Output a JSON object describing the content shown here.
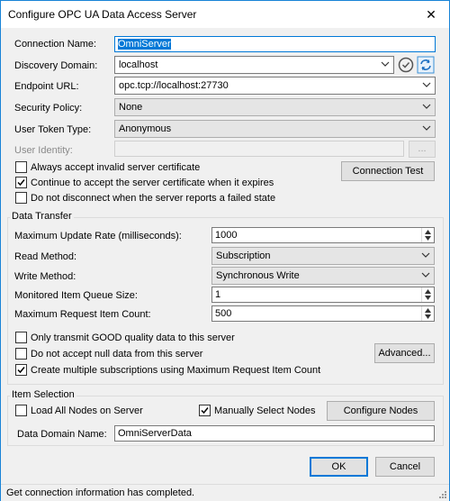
{
  "window": {
    "title": "Configure OPC UA Data Access Server",
    "close_label": "✕"
  },
  "connection": {
    "name_label": "Connection Name:",
    "name_value": "OmniServer",
    "discovery_label": "Discovery Domain:",
    "discovery_value": "localhost",
    "endpoint_label": "Endpoint URL:",
    "endpoint_value": "opc.tcp://localhost:27730",
    "security_label": "Security Policy:",
    "security_value": "None",
    "token_label": "User Token Type:",
    "token_value": "Anonymous",
    "identity_label": "User Identity:",
    "identity_value": "",
    "identity_browse_label": "..."
  },
  "options": {
    "accept_invalid": {
      "label": "Always accept invalid server certificate",
      "checked": false
    },
    "continue_accept": {
      "label": "Continue to accept the server certificate when it expires",
      "checked": true
    },
    "no_disconnect": {
      "label": "Do not disconnect when the server reports a failed state",
      "checked": false
    },
    "connection_test_label": "Connection Test"
  },
  "data_transfer": {
    "title": "Data Transfer",
    "update_rate_label": "Maximum Update Rate (milliseconds):",
    "update_rate_value": "1000",
    "read_method_label": "Read Method:",
    "read_method_value": "Subscription",
    "write_method_label": "Write Method:",
    "write_method_value": "Synchronous Write",
    "queue_size_label": "Monitored Item Queue Size:",
    "queue_size_value": "1",
    "max_request_label": "Maximum Request Item Count:",
    "max_request_value": "500",
    "only_good": {
      "label": "Only transmit GOOD quality data to this server",
      "checked": false
    },
    "no_null": {
      "label": "Do not accept null data from this server",
      "checked": false
    },
    "multi_subs": {
      "label": "Create multiple subscriptions using Maximum Request Item Count",
      "checked": true
    },
    "advanced_label": "Advanced..."
  },
  "item_selection": {
    "title": "Item Selection",
    "load_all": {
      "label": "Load All Nodes on Server",
      "checked": false
    },
    "manual": {
      "label": "Manually Select Nodes",
      "checked": true
    },
    "configure_label": "Configure Nodes",
    "domain_label": "Data Domain Name:",
    "domain_value": "OmniServerData"
  },
  "buttons": {
    "ok": "OK",
    "cancel": "Cancel"
  },
  "status": {
    "text": "Get connection information has completed."
  },
  "colors": {
    "accent": "#0078d7",
    "window_bg": "#f0f0f0",
    "border": "#1883d7"
  }
}
